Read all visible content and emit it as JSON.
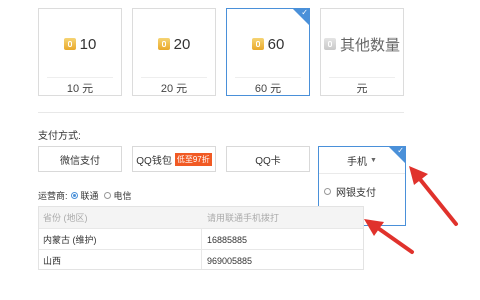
{
  "amount_cards": [
    {
      "amount": "10",
      "price": "10 元",
      "selected": false
    },
    {
      "amount": "20",
      "price": "20 元",
      "selected": false
    },
    {
      "amount": "60",
      "price": "60 元",
      "selected": true
    },
    {
      "amount": "其他数量",
      "price": "元",
      "selected": false
    }
  ],
  "payment": {
    "title": "支付方式:",
    "wechat_label": "微信支付",
    "qqwallet_label": "QQ钱包",
    "qqwallet_badge": "低至97折",
    "qqcard_label": "QQ卡",
    "mobile_label": "手机",
    "dropdown_options": [
      "网银支付",
      "手机"
    ],
    "dropdown_selected": "手机"
  },
  "operator": {
    "label": "运营商:",
    "options": [
      "联通",
      "电信"
    ],
    "selected": "联通"
  },
  "table": {
    "headers": [
      "省份 (地区)",
      "请用联通手机拨打"
    ],
    "rows": [
      [
        "内蒙古 (维护)",
        "16885885"
      ],
      [
        "山西",
        "969005885"
      ]
    ]
  },
  "colors": {
    "accent": "#4a90d9",
    "coin": "#f0b93a",
    "badge": "#f15a24",
    "arrow": "#e0322c"
  }
}
